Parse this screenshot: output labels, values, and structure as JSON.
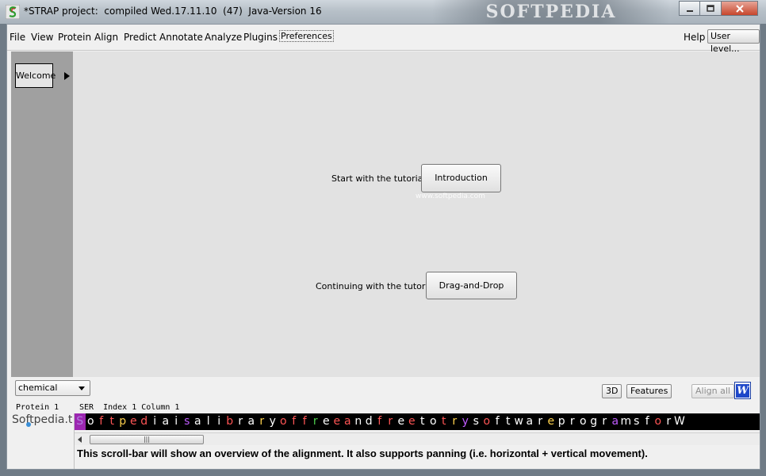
{
  "window": {
    "title": "*STRAP project:  compiled Wed.17.11.10  (47)  Java-Version 16",
    "watermark": "SOFTPEDIA"
  },
  "menubar": {
    "items": [
      "File",
      "View",
      "Protein",
      "Align",
      "Predict",
      "Annotate",
      "Analyze",
      "Plugins",
      "Preferences"
    ],
    "help": "Help",
    "user_level": "User level..."
  },
  "sidebar": {
    "welcome_tab": "Welcome"
  },
  "welcome": {
    "intro_label": "Start with the tutorial",
    "intro_button": "Introduction",
    "dnd_label": "Continuing with the tutorial",
    "dnd_button": "Drag-and-Drop",
    "faint_watermark": "www.softpedia.com"
  },
  "toolbar": {
    "color_mode": "chemical",
    "btn_3d": "3D",
    "btn_features": "Features",
    "btn_align_all": "Align all",
    "btn_word": "W"
  },
  "alignment": {
    "protein_header": "Protein 1",
    "residue_header": "SER  Index 1 Column 1",
    "sequence_name": "Softpedia.t",
    "sequence": "SoftpediaisalibraryoffreeandfreetotrysoftwareprogramsforW",
    "colors": [
      "#b07fe0",
      "#ffffff",
      "#ff5555",
      "#ff5555",
      "#ffd24d",
      "#ff5555",
      "#ff5555",
      "#ffffff",
      "#ffffff",
      "#ffffff",
      "#c05cff",
      "#ffffff",
      "#ffffff",
      "#ffffff",
      "#ff5555",
      "#ffffff",
      "#ffffff",
      "#ffd24d",
      "#ffffff",
      "#ff5555",
      "#ff5555",
      "#ff5555",
      "#4ed14e",
      "#ffffff",
      "#ff5555",
      "#ff5555",
      "#ffffff",
      "#ffffff",
      "#ff5555",
      "#ff5555",
      "#ffffff",
      "#ff5555",
      "#ffffff",
      "#ffffff",
      "#ff5555",
      "#ffd24d",
      "#c05cff",
      "#ffffff",
      "#ff5555",
      "#ffffff",
      "#ffffff",
      "#ffffff",
      "#ffffff",
      "#ffffff",
      "#ffd24d",
      "#ffffff",
      "#ffffff",
      "#ffffff",
      "#ffffff",
      "#ffffff",
      "#c05cff",
      "#ffffff",
      "#ffffff",
      "#ffffff",
      "#ff5555",
      "#ffffff"
    ],
    "scroll_thumb_grip": "|||",
    "scroll_note": "This scroll-bar will show an overview of the alignment. It also supports panning (i.e. horizontal + vertical movement)."
  }
}
